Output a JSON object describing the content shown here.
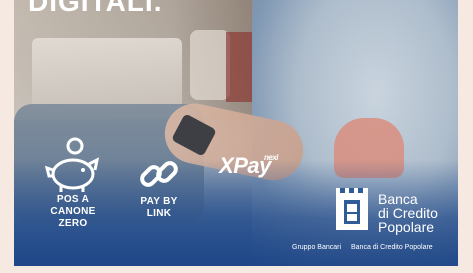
{
  "headline": "DIGITALI.",
  "features": [
    {
      "label_lines": [
        "POS A",
        "CANONE",
        "ZERO"
      ],
      "icon": "piggy-bank-icon"
    },
    {
      "label_lines": [
        "PAY BY",
        "LINK"
      ],
      "icon": "link-icon"
    }
  ],
  "xpay": {
    "brand": "XPay",
    "superscript": "nexi"
  },
  "bank": {
    "name_lines": [
      "Banca",
      "di Credito",
      "Popolare"
    ],
    "mark_icon": "bank-tower-icon"
  },
  "group_text": {
    "left": "Gruppo Bancari",
    "right": "Banca di Credito Popolare"
  },
  "colors": {
    "page_bg": "#f6e9e1",
    "overlay_blue": "#2f5c97",
    "text": "#ffffff"
  }
}
